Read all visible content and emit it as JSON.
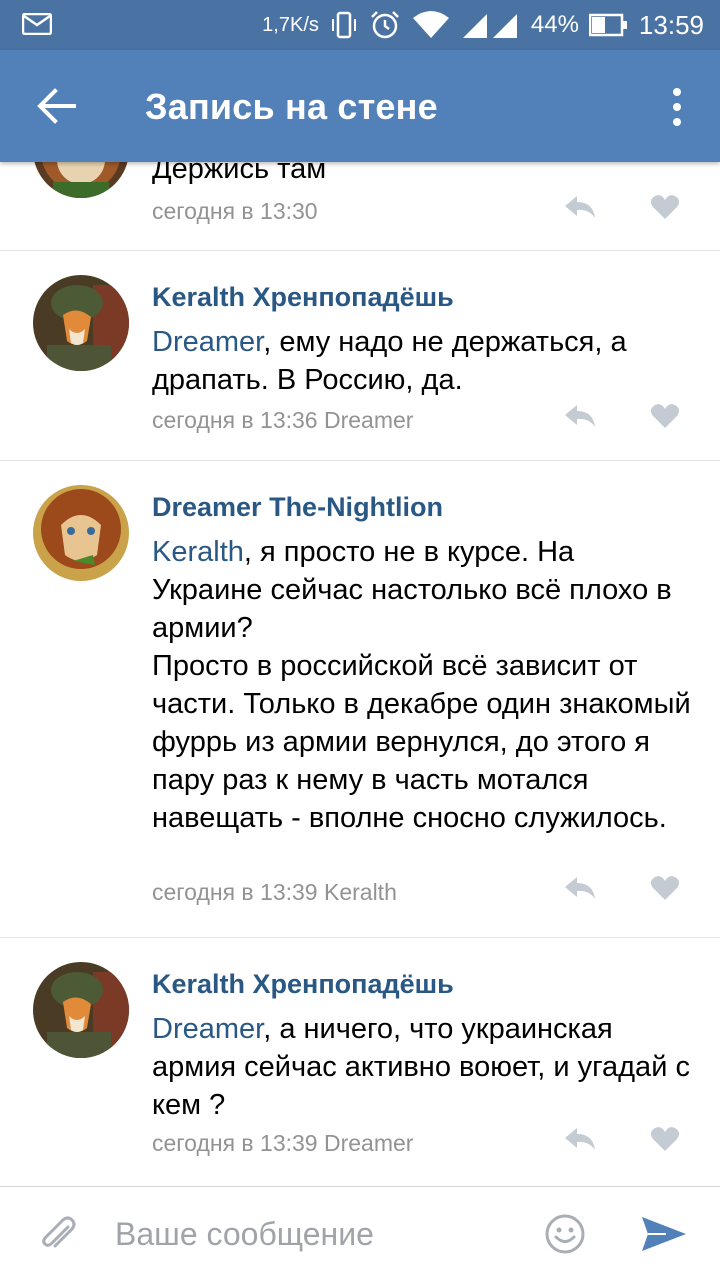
{
  "status_bar": {
    "speed": "1,7K/s",
    "battery": "44%",
    "time": "13:59",
    "icons": [
      "mail-icon",
      "vibrate-icon",
      "alarm-icon",
      "wifi-icon",
      "signal-icon",
      "battery-icon"
    ]
  },
  "header": {
    "title": "Запись на стене",
    "icons": [
      "back-arrow-icon",
      "more-vert-icon"
    ]
  },
  "colors": {
    "status_bar": "#4a73a3",
    "app_bar": "#5181b8",
    "link": "#2a5885",
    "meta": "#939393"
  },
  "comments": [
    {
      "text_lines": [
        "Держись там"
      ],
      "time": "сегодня в 13:30"
    },
    {
      "author": "Keralth Хренпопадёшь",
      "mention": "Dreamer",
      "text": ", ему надо не держаться, а драпать. В Россию, да.",
      "time": "сегодня в 13:36 Dreamer"
    },
    {
      "author": "Dreamer The-Nightlion",
      "mention": "Keralth",
      "text": ", я просто не в курсе. На Украине сейчас настолько всё плохо в армии?",
      "text2": "Просто в российской всё зависит от части. Только в декабре один знакомый фуррь из армии вернулся, до этого я пару раз к нему в часть мотался навещать - вполне сносно служилось.",
      "time": "сегодня в 13:39 Keralth"
    },
    {
      "author": "Keralth Хренпопадёшь",
      "mention": "Dreamer",
      "text": ", а ничего, что украинская армия сейчас активно воюет, и угадай с кем ?",
      "time": "сегодня в 13:39 Dreamer"
    }
  ],
  "composer": {
    "placeholder": "Ваше сообщение",
    "icons": [
      "attach-icon",
      "emoji-icon",
      "send-icon"
    ]
  }
}
